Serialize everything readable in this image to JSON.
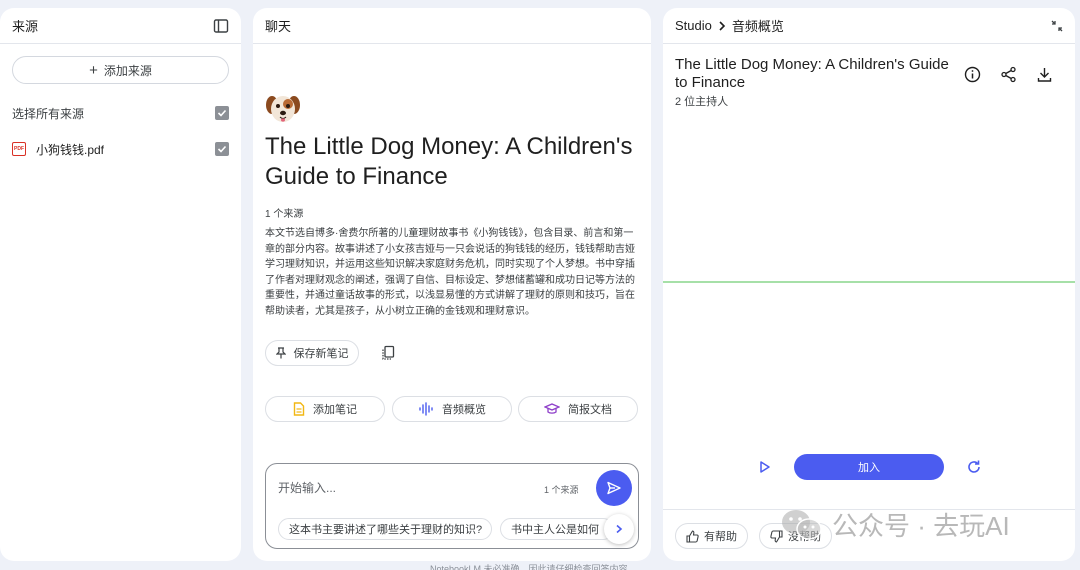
{
  "sources": {
    "title": "来源",
    "add_label": "添加来源",
    "select_all_label": "选择所有来源",
    "files": [
      {
        "name": "小狗钱钱.pdf",
        "type": "PDF",
        "checked": true
      }
    ],
    "select_all_checked": true
  },
  "chat": {
    "title": "聊天",
    "doc_title": "The Little Dog Money: A Children's Guide to Finance",
    "source_count": "1 个来源",
    "summary": "本文节选自博多·舍费尔所著的儿童理财故事书《小狗钱钱》，包含目录、前言和第一章的部分内容。故事讲述了小女孩吉娅与一只会说话的狗钱钱的经历，钱钱帮助吉娅学习理财知识，并运用这些知识解决家庭财务危机，同时实现了个人梦想。书中穿插了作者对理财观念的阐述，强调了自信、目标设定、梦想储蓄罐和成功日记等方法的重要性，并通过童话故事的形式，以浅显易懂的方式讲解了理财的原则和技巧，旨在帮助读者，尤其是孩子，从小树立正确的金钱观和理财意识。",
    "save_note_label": "保存新笔记",
    "actions": [
      "添加笔记",
      "音频概览",
      "简报文档"
    ],
    "input_placeholder": "开始输入...",
    "input_source_count": "1 个来源",
    "suggestions": [
      "这本书主要讲述了哪些关于理财的知识?",
      "书中主人公是如何"
    ],
    "footer": "NotebookLM 未必准确，因此请仔细检查回答内容。"
  },
  "studio": {
    "breadcrumb_root": "Studio",
    "breadcrumb_current": "音频概览",
    "audio_title": "The Little Dog Money: A Children's Guide to Finance",
    "hosts": "2 位主持人",
    "join_label": "加入",
    "helpful_label": "有帮助",
    "not_helpful_label": "没帮助"
  },
  "watermark": "公众号 · 去玩AI",
  "colors": {
    "accent": "#4b5cf0",
    "wave": "#a6e0a8",
    "background": "#eef1f8"
  }
}
